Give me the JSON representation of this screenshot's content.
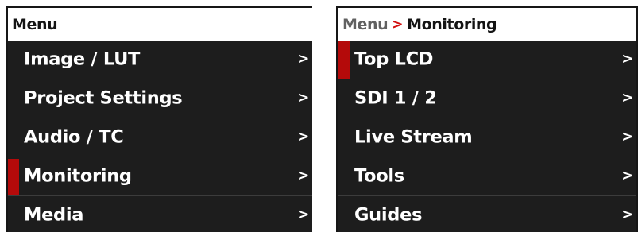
{
  "left_panel": {
    "title": "Menu",
    "items": [
      {
        "label": "Image / LUT",
        "chevron": ">",
        "selected": false
      },
      {
        "label": "Project Settings",
        "chevron": ">",
        "selected": false
      },
      {
        "label": "Audio / TC",
        "chevron": ">",
        "selected": false
      },
      {
        "label": "Monitoring",
        "chevron": ">",
        "selected": true
      },
      {
        "label": "Media",
        "chevron": ">",
        "selected": false
      }
    ]
  },
  "right_panel": {
    "breadcrumb_root": "Menu",
    "breadcrumb_separator": ">",
    "breadcrumb_current": "Monitoring",
    "items": [
      {
        "label": "Top LCD",
        "chevron": ">",
        "selected": true
      },
      {
        "label": "SDI 1 / 2",
        "chevron": ">",
        "selected": false
      },
      {
        "label": "Live Stream",
        "chevron": ">",
        "selected": false
      },
      {
        "label": "Tools",
        "chevron": ">",
        "selected": false
      },
      {
        "label": "Guides",
        "chevron": ">",
        "selected": false
      }
    ]
  },
  "colors": {
    "selection_marker": "#b40a0a",
    "breadcrumb_separator": "#d10e0e",
    "menu_background": "#1d1d1d",
    "header_background": "#ffffff"
  }
}
